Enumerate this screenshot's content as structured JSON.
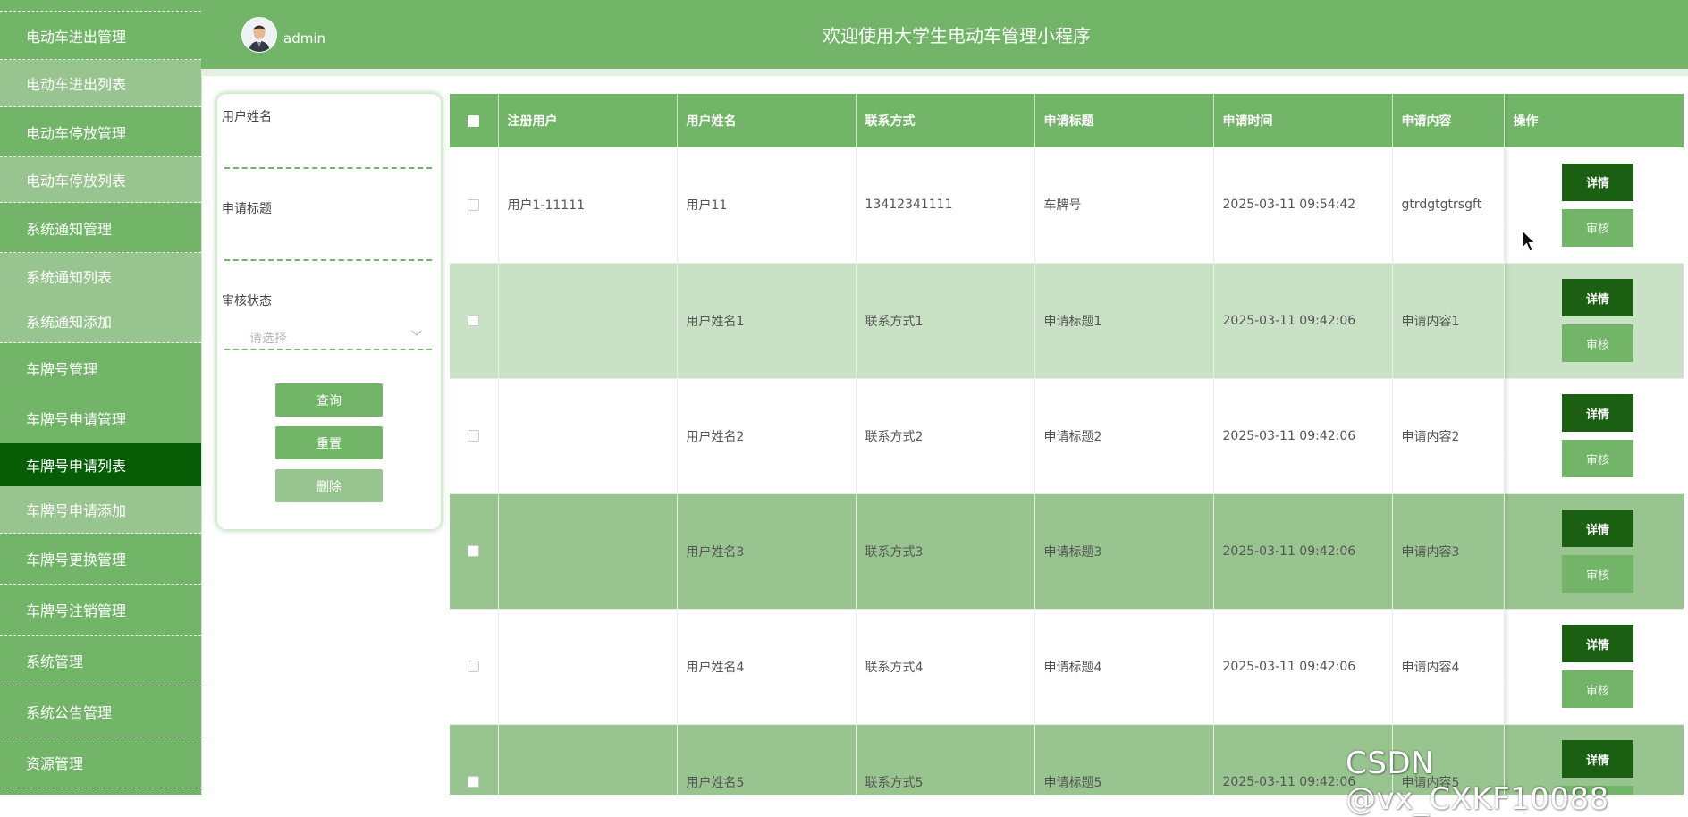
{
  "header": {
    "username": "admin",
    "title": "欢迎使用大学生电动车管理小程序"
  },
  "sidebar": {
    "items": [
      {
        "label": "电动车进出管理",
        "type": "group"
      },
      {
        "label": "电动车进出列表",
        "type": "sub"
      },
      {
        "label": "电动车停放管理",
        "type": "group"
      },
      {
        "label": "电动车停放列表",
        "type": "sub"
      },
      {
        "label": "系统通知管理",
        "type": "group"
      },
      {
        "label": "系统通知列表",
        "type": "sub"
      },
      {
        "label": "系统通知添加",
        "type": "sub"
      },
      {
        "label": "车牌号管理",
        "type": "group"
      },
      {
        "label": "车牌号申请管理",
        "type": "group"
      },
      {
        "label": "车牌号申请列表",
        "type": "active"
      },
      {
        "label": "车牌号申请添加",
        "type": "sub"
      },
      {
        "label": "车牌号更换管理",
        "type": "group"
      },
      {
        "label": "车牌号注销管理",
        "type": "group"
      },
      {
        "label": "系统管理",
        "type": "group"
      },
      {
        "label": "系统公告管理",
        "type": "group"
      },
      {
        "label": "资源管理",
        "type": "group"
      }
    ]
  },
  "search": {
    "name_label": "用户姓名",
    "title_label": "申请标题",
    "status_label": "审核状态",
    "status_placeholder": "请选择",
    "query_button": "查询",
    "reset_button": "重置",
    "delete_button": "删除"
  },
  "table": {
    "columns": [
      "注册用户",
      "用户姓名",
      "联系方式",
      "申请标题",
      "申请时间",
      "申请内容",
      "操作"
    ],
    "detail_label": "详情",
    "audit_label": "审核",
    "rows": [
      {
        "user": "用户1-11111",
        "name": "用户11",
        "contact": "13412341111",
        "title": "车牌号",
        "time": "2025-03-11 09:54:42",
        "content": "gtrdgtgtrsgft"
      },
      {
        "user": "",
        "name": "用户姓名1",
        "contact": "联系方式1",
        "title": "申请标题1",
        "time": "2025-03-11 09:42:06",
        "content": "申请内容1"
      },
      {
        "user": "",
        "name": "用户姓名2",
        "contact": "联系方式2",
        "title": "申请标题2",
        "time": "2025-03-11 09:42:06",
        "content": "申请内容2"
      },
      {
        "user": "",
        "name": "用户姓名3",
        "contact": "联系方式3",
        "title": "申请标题3",
        "time": "2025-03-11 09:42:06",
        "content": "申请内容3"
      },
      {
        "user": "",
        "name": "用户姓名4",
        "contact": "联系方式4",
        "title": "申请标题4",
        "time": "2025-03-11 09:42:06",
        "content": "申请内容4"
      },
      {
        "user": "",
        "name": "用户姓名5",
        "contact": "联系方式5",
        "title": "申请标题5",
        "time": "2025-03-11 09:42:06",
        "content": "申请内容5"
      }
    ]
  },
  "watermark": "CSDN @vx_CXKF10088",
  "colors": {
    "primary": "#72b568",
    "light": "#98c48f",
    "active": "#065d06",
    "detail": "#1a5f12"
  }
}
